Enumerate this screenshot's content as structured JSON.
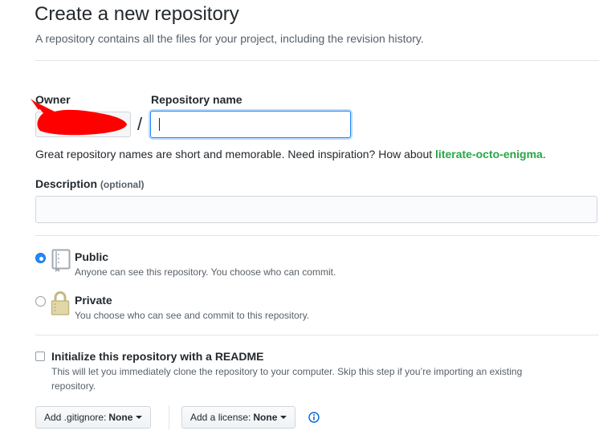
{
  "page": {
    "title": "Create a new repository",
    "subtitle": "A repository contains all the files for your project, including the revision history."
  },
  "owner": {
    "label": "Owner",
    "value": ""
  },
  "separator": "/",
  "repo_name": {
    "label": "Repository name",
    "value": "",
    "placeholder": ""
  },
  "hint": {
    "text": "Great repository names are short and memorable. Need inspiration? How about ",
    "suggestion": "literate-octo-enigma",
    "end": "."
  },
  "description": {
    "label": "Description",
    "optional": "(optional)",
    "value": ""
  },
  "visibility": {
    "selected": "public",
    "public": {
      "title": "Public",
      "note": "Anyone can see this repository. You choose who can commit.",
      "icon": "repo-book-icon"
    },
    "private": {
      "title": "Private",
      "note": "You choose who can see and commit to this repository.",
      "icon": "lock-icon"
    }
  },
  "readme": {
    "checked": false,
    "title": "Initialize this repository with a README",
    "note_line1": "This will let you immediately clone the repository to your computer. Skip this step if you’re importing an existing",
    "note_line2": "repository."
  },
  "gitignore": {
    "label": "Add .gitignore:",
    "value": "None"
  },
  "license": {
    "label": "Add a license:",
    "value": "None"
  },
  "colors": {
    "accent": "#2188ff",
    "suggestion": "#28a745",
    "redaction": "#ff0000"
  }
}
